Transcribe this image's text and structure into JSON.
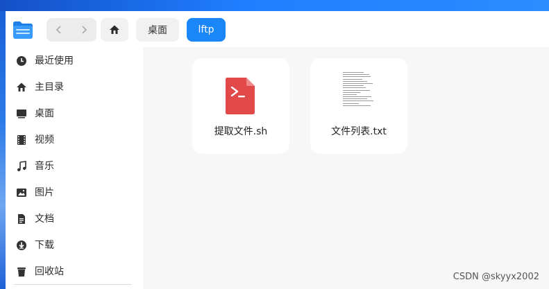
{
  "toolbar": {
    "back_icon": "chevron-left-icon",
    "forward_icon": "chevron-right-icon",
    "home_icon": "home-icon",
    "breadcrumbs": [
      "桌面",
      "lftp"
    ]
  },
  "sidebar": {
    "items": [
      {
        "label": "最近使用",
        "icon": "clock-icon"
      },
      {
        "label": "主目录",
        "icon": "home-icon"
      },
      {
        "label": "桌面",
        "icon": "monitor-icon"
      },
      {
        "label": "视频",
        "icon": "film-icon"
      },
      {
        "label": "音乐",
        "icon": "music-note-icon"
      },
      {
        "label": "图片",
        "icon": "image-icon"
      },
      {
        "label": "文档",
        "icon": "document-icon"
      },
      {
        "label": "下载",
        "icon": "download-icon"
      },
      {
        "label": "回收站",
        "icon": "trash-icon"
      }
    ]
  },
  "files": [
    {
      "name": "提取文件.sh",
      "icon": "shell-script-icon",
      "color": "#e24a4a"
    },
    {
      "name": "文件列表.txt",
      "icon": "text-file-preview-icon"
    }
  ],
  "watermark": "CSDN @skyyx2002",
  "colors": {
    "accent": "#1a86f8",
    "script_red": "#e24a4a"
  }
}
